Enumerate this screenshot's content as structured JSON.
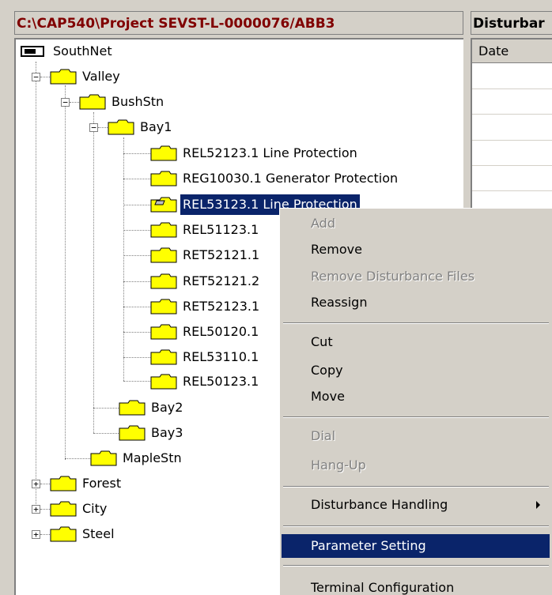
{
  "title_left": "C:\\CAP540\\Project  SEVST-L-0000076/ABB3",
  "title_right": "Disturbar",
  "right_pane": {
    "column_header": "Date"
  },
  "tree": {
    "root": "SouthNet",
    "valley": "Valley",
    "bushstn": "BushStn",
    "bay1": "Bay1",
    "bay1_items": [
      "REL52123.1  Line Protection",
      "REG10030.1  Generator Protection",
      "REL53123.1  Line Protection",
      "REL51123.1",
      "RET52121.1",
      "RET52121.2",
      "RET52123.1",
      "REL50120.1",
      "REL53110.1",
      "REL50123.1"
    ],
    "bay2": "Bay2",
    "bay3": "Bay3",
    "maplestn": "MapleStn",
    "forest": "Forest",
    "city": "City",
    "steel": "Steel"
  },
  "context_menu": {
    "add": "Add",
    "remove": "Remove",
    "remove_disturbance": "Remove Disturbance Files",
    "reassign": "Reassign",
    "cut": "Cut",
    "copy": "Copy",
    "move": "Move",
    "dial": "Dial",
    "hangup": "Hang-Up",
    "disturbance_handling": "Disturbance Handling",
    "parameter_setting": "Parameter Setting",
    "terminal_config": "Terminal Configuration"
  },
  "colors": {
    "selection": "#0a246a",
    "folder": "#ffff00",
    "title_text": "#800000"
  }
}
